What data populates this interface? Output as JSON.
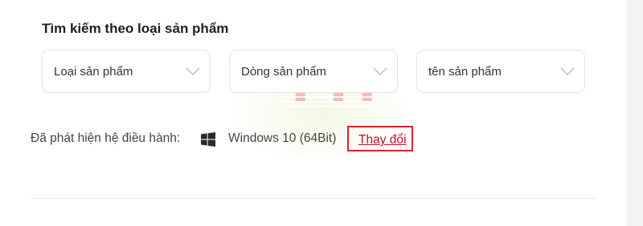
{
  "search": {
    "title": "Tìm kiếm theo loại sản phẩm",
    "selects": [
      {
        "label": "Loại sản phẩm",
        "icon": "chevron-down-icon"
      },
      {
        "label": "Dòng sản phẩm",
        "icon": "chevron-down-icon"
      },
      {
        "label": "tên sản phẩm",
        "icon": "chevron-down-icon"
      }
    ]
  },
  "os": {
    "detected_label": "Đã phát hiện hệ điều hành:",
    "icon": "windows-logo-icon",
    "name": "Windows 10 (64Bit)",
    "change_link": "Thay đổi"
  },
  "watermark": {
    "text": "TTP"
  },
  "colors": {
    "highlight_border": "#d8232a",
    "link": "#c8102e",
    "border": "#e3e3e3",
    "text": "#222222"
  }
}
